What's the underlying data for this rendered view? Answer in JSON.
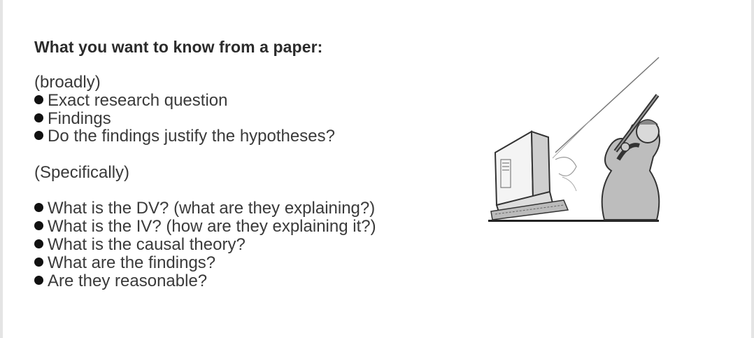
{
  "title": "What you want to know from a paper:",
  "broadly": {
    "heading": "(broadly)",
    "items": [
      "Exact research question",
      "Findings",
      "Do the findings justify the hypotheses?"
    ]
  },
  "specifically": {
    "heading": "(Specifically)",
    "items": [
      "What is the DV? (what are they explaining?)",
      "What is the IV? (how are they explaining it?)",
      "What is the causal theory?",
      "What are the findings?",
      "Are they reasonable?"
    ]
  },
  "image": {
    "icon": "cartoon-man-shooting-computer-illustration"
  }
}
